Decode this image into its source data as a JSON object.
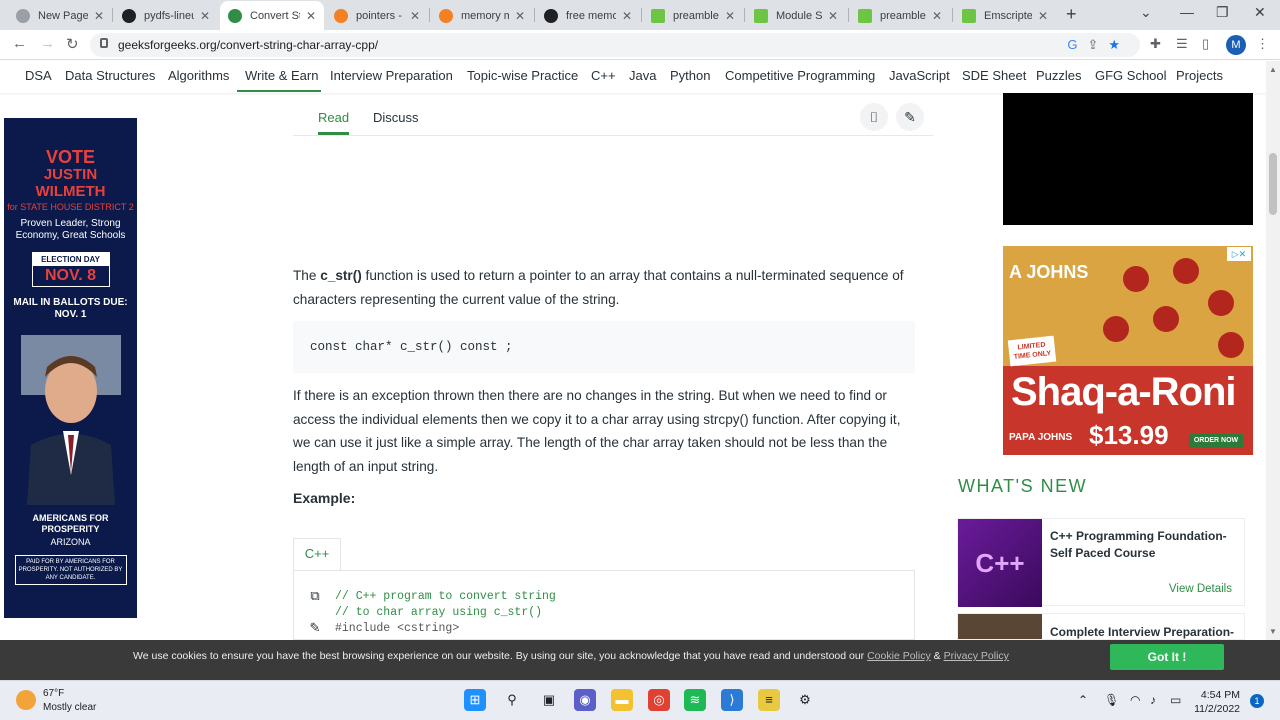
{
  "browser": {
    "tabs": [
      {
        "label": "New Page Tab",
        "color": "#5f6368"
      },
      {
        "label": "pydfs-lineup",
        "color": "#202124"
      },
      {
        "label": "Convert String",
        "color": "#2f8d46"
      },
      {
        "label": "pointers - C",
        "color": "#f48024"
      },
      {
        "label": "memory mgmt",
        "color": "#f48024"
      },
      {
        "label": "free memory",
        "color": "#202124"
      },
      {
        "label": "preamble.js",
        "color": "#6cc644"
      },
      {
        "label": "Module Split",
        "color": "#6cc644"
      },
      {
        "label": "preamble.js",
        "color": "#6cc644"
      },
      {
        "label": "Emscripten",
        "color": "#6cc644"
      }
    ],
    "url": "geeksforgeeks.org/convert-string-char-array-cpp/",
    "avatar_letter": "M"
  },
  "sitenav": {
    "items": [
      "DSA",
      "Data Structures",
      "Algorithms",
      "Write & Earn",
      "Interview Preparation",
      "Topic-wise Practice",
      "C++",
      "Java",
      "Python",
      "Competitive Programming",
      "JavaScript",
      "SDE Sheet",
      "Puzzles",
      "GFG School",
      "Projects"
    ]
  },
  "article": {
    "read_tab": "Read",
    "discuss_tab": "Discuss",
    "para1_pre": "The ",
    "para1_bold": "c_str()",
    "para1_post": " function is used to return a pointer to an array that contains a null-terminated sequence of characters representing the current value of the string.",
    "code_signature": "const char* c_str() const ;",
    "para2": "If there is an exception thrown then there are no changes in the string. But when we need to find or access the individual elements then we copy it to a char array using strcpy() function. After copying it, we can use it just like a simple array. The length of the char array taken should not be less than the length of an input string.",
    "example_label": "Example:",
    "lang_tab": "C++",
    "code_lines": [
      "// C++ program to convert string",
      "// to char array using c_str()",
      "#include <cstring>"
    ]
  },
  "left_ad": {
    "vote": "VOTE",
    "name1": "JUSTIN",
    "name2": "WILMETH",
    "district": "for STATE HOUSE DISTRICT 2",
    "slogan": "Proven Leader, Strong Economy, Great Schools",
    "election_label": "ELECTION DAY",
    "election_date": "NOV. 8",
    "mail": "MAIL IN BALLOTS DUE: NOV. 1",
    "afp": "AMERICANS FOR PROSPERITY",
    "afp_sub": "ARIZONA",
    "paid": "PAID FOR BY AMERICANS FOR PROSPERITY. NOT AUTHORIZED BY ANY CANDIDATE."
  },
  "right_ad": {
    "brand": "A JOHNS",
    "limited": "LIMITED TIME ONLY",
    "product": "Shaq-a-Roni",
    "pj": "PAPA JOHNS",
    "price": "$13.99",
    "order": "ORDER NOW"
  },
  "whats_new": {
    "heading": "WHAT'S NEW",
    "cards": [
      {
        "thumb": "C++",
        "title": "C++ Programming Foundation- Self Paced Course",
        "link": "View Details"
      },
      {
        "thumb": "",
        "title": "Complete Interview Preparation-",
        "link": ""
      }
    ]
  },
  "cookie": {
    "message": "We use cookies to ensure you have the best browsing experience on our website. By using our site, you acknowledge that you have read and understood our ",
    "cookie_policy": "Cookie Policy",
    "amp": " & ",
    "privacy_policy": "Privacy Policy",
    "button": "Got It !"
  },
  "taskbar": {
    "temp": "67°F",
    "weather": "Mostly clear",
    "time": "4:54 PM",
    "date": "11/2/2022",
    "notif": "1"
  },
  "colors": {
    "gfg_green": "#2f8d46",
    "cookie_button": "#2fb85a"
  }
}
